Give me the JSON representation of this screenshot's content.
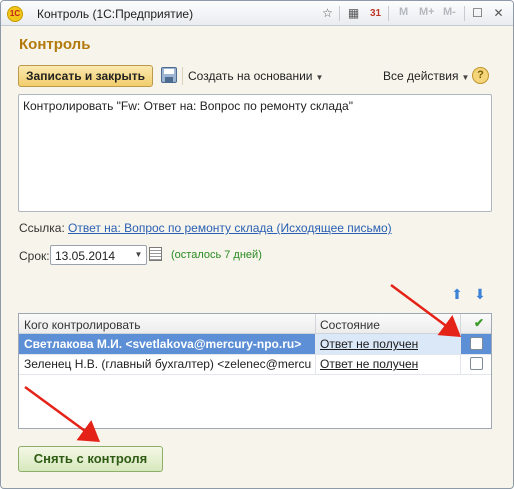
{
  "window": {
    "title": "Контроль  (1С:Предприятие)",
    "logo_text": "1С",
    "title_buttons": {
      "memory_m": "M",
      "memory_plus": "M+",
      "memory_minus": "M-"
    }
  },
  "form": {
    "title": "Контроль"
  },
  "toolbar": {
    "save_close_label": "Записать и закрыть",
    "create_based_label": "Создать на основании",
    "all_actions_label": "Все действия",
    "help_label": "?"
  },
  "content": {
    "text": "Контролировать \"Fw: Ответ на: Вопрос по ремонту склада\""
  },
  "link_row": {
    "label": "Ссылка:",
    "value": "Ответ на: Вопрос по ремонту склада (Исходящее письмо)"
  },
  "deadline": {
    "label": "Срок:",
    "value": "13.05.2014",
    "remaining": "(осталось 7 дней)"
  },
  "table": {
    "columns": [
      "Кого контролировать",
      "Состояние"
    ],
    "check_header": "✔",
    "rows": [
      {
        "name": "Светлакова М.И. <svetlakova@mercury-npo.ru>",
        "status": "Ответ не получен",
        "checked": false,
        "selected": true
      },
      {
        "name": "Зеленец Н.В. (главный бухгалтер) <zelenec@mercury-n...",
        "status": "Ответ не получен",
        "checked": false,
        "selected": false
      }
    ]
  },
  "footer": {
    "remove_control_label": "Снять с контроля"
  },
  "colors": {
    "accent_title": "#b27a0c",
    "selection": "#5c8fd6",
    "annotation_arrow": "#e52218",
    "remaining_text": "#2a8a22"
  }
}
